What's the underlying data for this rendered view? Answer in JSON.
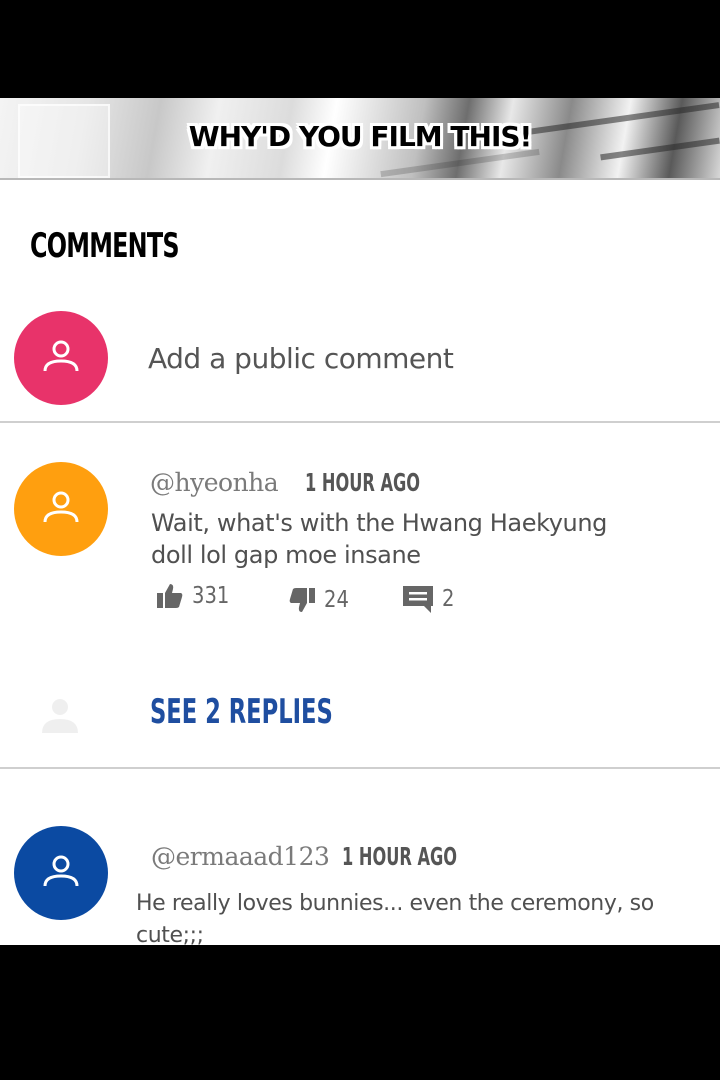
{
  "banner": {
    "caption": "WHY'D YOU FILM THIS!"
  },
  "comments_section": {
    "heading": "COMMENTS",
    "compose": {
      "placeholder": "Add a public comment",
      "avatar_color": "#e8336a",
      "avatar_icon": "person-icon"
    },
    "comments": [
      {
        "handle": "@hyeonha",
        "time": "1 HOUR AGO",
        "text_line1": "Wait, what's with the Hwang Haekyung",
        "text_line2": "doll lol gap moe insane",
        "likes": "331",
        "dislikes": "24",
        "replies": "2",
        "avatar_color": "#ff9f0f",
        "see_replies_label": "SEE 2 REPLIES"
      },
      {
        "handle": "@ermaaad123",
        "time": "1 HOUR AGO",
        "text_line1": "He really loves bunnies... even the ceremony, so cute;;;",
        "avatar_color": "#0b4aa2"
      }
    ]
  },
  "colors": {
    "link_blue": "#1f4ea0",
    "divider": "#cfcfcf",
    "background": "#ffffff",
    "frame": "#000000"
  },
  "icons": [
    "person-icon",
    "thumbs-up-icon",
    "thumbs-down-icon",
    "reply-icon"
  ]
}
